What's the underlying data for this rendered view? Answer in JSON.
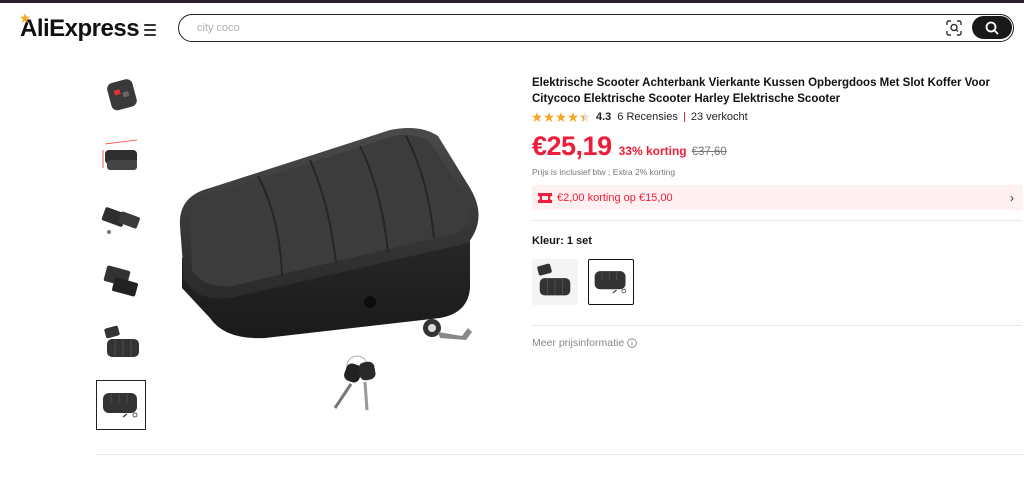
{
  "header": {
    "logo_text": "AliExpress",
    "search_placeholder": "city coco",
    "search_value": ""
  },
  "thumbnails": [
    {
      "name": "thumb-1",
      "icon": "remote-control"
    },
    {
      "name": "thumb-2",
      "icon": "box-dimensions"
    },
    {
      "name": "thumb-3",
      "icon": "box-open"
    },
    {
      "name": "thumb-4",
      "icon": "box-open-inside"
    },
    {
      "name": "thumb-5",
      "icon": "box-and-cushion"
    },
    {
      "name": "thumb-6",
      "icon": "box-with-keys",
      "selected": true
    }
  ],
  "product": {
    "title": "Elektrische Scooter Achterbank Vierkante Kussen Opbergdoos Met Slot Koffer Voor Citycoco Elektrische Scooter Harley Elektrische Scooter",
    "rating_score": "4.3",
    "reviews": "6 Recensies",
    "sold": "23 verkocht",
    "stars_filled": 4,
    "price": "€25,19",
    "discount": "33% korting",
    "old_price": "€37,60",
    "tax_note": "Prijs is inclusief btw ; Extra 2% korting",
    "coupon": "€2,00 korting op €15,00",
    "color_label": "Kleur: 1 set",
    "more_price_info": "Meer prijsinformatie"
  },
  "colors": {
    "accent_red": "#ee1d3a",
    "coupon_bg": "#fff0f1",
    "star": "#f5a623"
  }
}
